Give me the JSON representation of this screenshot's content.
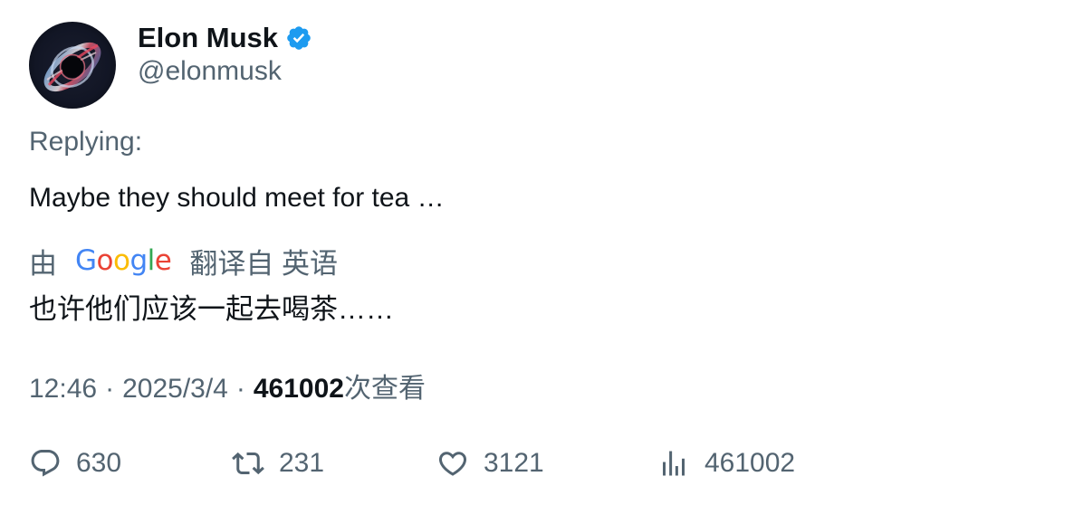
{
  "author": {
    "display_name": "Elon Musk",
    "handle": "@elonmusk",
    "verified": true,
    "verified_color": "#1d9bf0",
    "avatar_icon": "black-hole-avatar-icon"
  },
  "tweet": {
    "replying_label": "Replying:",
    "text": "Maybe they should meet for tea …"
  },
  "translation": {
    "by_label": "由",
    "provider_logo_text": "Google",
    "from_label": "翻译自 英语",
    "text": "也许他们应该一起去喝茶……"
  },
  "meta": {
    "time": "12:46",
    "separator": "·",
    "date": "2025/3/4",
    "views_count": "461002",
    "views_label": "次查看"
  },
  "actions": {
    "reply": {
      "icon": "reply-icon",
      "count": "630"
    },
    "retweet": {
      "icon": "retweet-icon",
      "count": "231"
    },
    "like": {
      "icon": "heart-icon",
      "count": "3121"
    },
    "views": {
      "icon": "views-chart-icon",
      "count": "461002"
    }
  },
  "colors": {
    "primary_text": "#0f1419",
    "secondary_text": "#536471",
    "google_blue": "#4285F4",
    "google_red": "#EA4335",
    "google_yellow": "#FBBC05",
    "google_green": "#34A853"
  }
}
